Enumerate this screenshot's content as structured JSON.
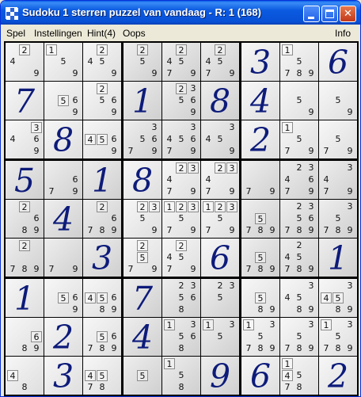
{
  "window": {
    "title": "Sudoku 1 sterren puzzel van vandaag - R: 1 (168)"
  },
  "menu": {
    "items": [
      "Spel",
      "Instellingen",
      "Hint(4)",
      "Oops",
      "Info"
    ]
  },
  "colors": {
    "given_digit": "#0d1b7a",
    "title_bar": "#0b5ae0"
  },
  "board": {
    "givens": [
      [
        "",
        "",
        "",
        "",
        "",
        "",
        "3",
        "",
        "6"
      ],
      [
        "7",
        "",
        "",
        "1",
        "",
        "8",
        "4",
        "",
        ""
      ],
      [
        "",
        "8",
        "",
        "",
        "",
        "",
        "2",
        "",
        ""
      ],
      [
        "5",
        "",
        "1",
        "8",
        "",
        "",
        "",
        "",
        ""
      ],
      [
        "",
        "4",
        "",
        "",
        "",
        "",
        "",
        "",
        ""
      ],
      [
        "",
        "",
        "3",
        "",
        "",
        "6",
        "",
        "",
        "1"
      ],
      [
        "1",
        "",
        "",
        "7",
        "",
        "",
        "",
        "",
        ""
      ],
      [
        "",
        "2",
        "",
        "4",
        "",
        "",
        "",
        "",
        ""
      ],
      [
        "",
        "3",
        "",
        "",
        "",
        "9",
        "6",
        "",
        "2"
      ]
    ],
    "candidates": [
      [
        [
          [
            2,
            4,
            9
          ],
          [
            2
          ]
        ],
        [
          [
            1,
            5,
            9
          ],
          [
            1
          ]
        ],
        [
          [
            2,
            4,
            5,
            9
          ],
          [
            2
          ]
        ],
        [
          [
            2,
            5,
            9
          ],
          [
            2
          ]
        ],
        [
          [
            2,
            4,
            5,
            7,
            9
          ],
          [
            2
          ]
        ],
        [
          [
            2,
            4,
            5,
            7,
            9
          ],
          [
            2
          ]
        ],
        [],
        [
          [
            1,
            5,
            7,
            8,
            9
          ],
          [
            1
          ]
        ],
        []
      ],
      [
        [],
        [
          [
            5,
            6,
            9
          ],
          [
            5
          ]
        ],
        [
          [
            2,
            5,
            6,
            9
          ],
          [
            2
          ]
        ],
        [],
        [
          [
            2,
            3,
            5,
            6,
            9
          ],
          [
            2
          ]
        ],
        [],
        [],
        [
          [
            5,
            9
          ],
          []
        ],
        [
          [
            5,
            9
          ],
          []
        ]
      ],
      [
        [
          [
            3,
            4,
            6,
            9
          ],
          [
            3
          ]
        ],
        [],
        [
          [
            4,
            5,
            6,
            9
          ],
          [
            4,
            5
          ]
        ],
        [
          [
            3,
            5,
            6,
            7,
            9
          ],
          []
        ],
        [
          [
            3,
            4,
            5,
            6,
            7,
            9
          ],
          []
        ],
        [
          [
            3,
            4,
            5,
            9
          ],
          []
        ],
        [],
        [
          [
            1,
            5,
            7,
            9
          ],
          [
            1
          ]
        ],
        [
          [
            5,
            7,
            9
          ],
          []
        ]
      ],
      [
        [],
        [
          [
            6,
            7,
            9
          ],
          []
        ],
        [],
        [],
        [
          [
            2,
            3,
            4,
            7,
            9
          ],
          [
            2,
            3
          ]
        ],
        [
          [
            2,
            3,
            4,
            7,
            9
          ],
          [
            2,
            3
          ]
        ],
        [
          [
            7,
            9
          ],
          []
        ],
        [
          [
            2,
            3,
            4,
            6,
            7,
            9
          ],
          []
        ],
        [
          [
            3,
            4,
            7,
            9
          ],
          []
        ]
      ],
      [
        [
          [
            2,
            6,
            8,
            9
          ],
          [
            2
          ]
        ],
        [],
        [
          [
            2,
            6,
            7,
            8,
            9
          ],
          [
            2
          ]
        ],
        [
          [
            2,
            3,
            5,
            9
          ],
          [
            2,
            3
          ]
        ],
        [
          [
            1,
            2,
            3,
            5,
            7,
            9
          ],
          [
            1,
            2,
            3
          ]
        ],
        [
          [
            1,
            2,
            3,
            5,
            7,
            9
          ],
          [
            1,
            2,
            3
          ]
        ],
        [
          [
            5,
            7,
            8,
            9
          ],
          [
            5
          ]
        ],
        [
          [
            2,
            3,
            5,
            6,
            7,
            8,
            9
          ],
          []
        ],
        [
          [
            3,
            5,
            7,
            8,
            9
          ],
          []
        ]
      ],
      [
        [
          [
            2,
            7,
            8,
            9
          ],
          [
            2
          ]
        ],
        [
          [
            7,
            9
          ],
          []
        ],
        [],
        [
          [
            2,
            5,
            7,
            9
          ],
          [
            2,
            5
          ]
        ],
        [
          [
            2,
            4,
            5,
            7,
            9
          ],
          [
            2
          ]
        ],
        [],
        [
          [
            5,
            7,
            8,
            9
          ],
          [
            5
          ]
        ],
        [
          [
            2,
            4,
            5,
            7,
            8,
            9
          ],
          []
        ],
        []
      ],
      [
        [],
        [
          [
            5,
            6,
            9
          ],
          [
            5
          ]
        ],
        [
          [
            4,
            5,
            6,
            8,
            9
          ],
          [
            4,
            5
          ]
        ],
        [],
        [
          [
            2,
            3,
            5,
            6,
            8
          ],
          []
        ],
        [
          [
            2,
            3,
            5
          ],
          []
        ],
        [
          [
            5,
            8,
            9
          ],
          [
            5
          ]
        ],
        [
          [
            3,
            4,
            5,
            8,
            9
          ],
          []
        ],
        [
          [
            3,
            4,
            5,
            8,
            9
          ],
          [
            4,
            5
          ]
        ]
      ],
      [
        [
          [
            6,
            8,
            9
          ],
          [
            6
          ]
        ],
        [],
        [
          [
            5,
            6,
            7,
            8,
            9
          ],
          [
            5
          ]
        ],
        [],
        [
          [
            1,
            3,
            5,
            6,
            8
          ],
          [
            1
          ]
        ],
        [
          [
            1,
            3,
            5
          ],
          [
            1
          ]
        ],
        [
          [
            1,
            3,
            5,
            7,
            8,
            9
          ],
          [
            1
          ]
        ],
        [
          [
            3,
            5,
            7,
            8,
            9
          ],
          []
        ],
        [
          [
            1,
            3,
            5,
            7,
            8,
            9
          ],
          [
            1
          ]
        ]
      ],
      [
        [
          [
            4,
            8
          ],
          [
            4
          ]
        ],
        [],
        [
          [
            4,
            5,
            7,
            8
          ],
          [
            4,
            5
          ]
        ],
        [
          [
            5
          ],
          [
            5
          ]
        ],
        [
          [
            1,
            5,
            8
          ],
          [
            1
          ]
        ],
        [],
        [],
        [
          [
            1,
            4,
            5,
            7,
            8
          ],
          [
            1,
            4
          ]
        ],
        []
      ]
    ]
  }
}
